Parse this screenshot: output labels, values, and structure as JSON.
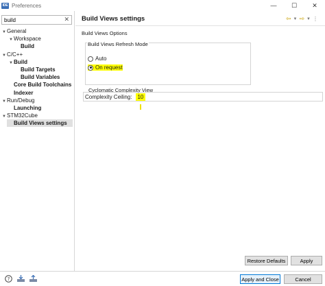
{
  "window": {
    "app_icon_text": "IDE",
    "title": "Preferences",
    "minimize_glyph": "—",
    "maximize_glyph": "☐",
    "close_glyph": "✕"
  },
  "filter": {
    "value": "build",
    "clear_glyph": "✕"
  },
  "tree": [
    {
      "label": "General",
      "indent": 0,
      "arrow": "▼",
      "bold": false,
      "selected": false
    },
    {
      "label": "Workspace",
      "indent": 1,
      "arrow": "▼",
      "bold": false,
      "selected": false
    },
    {
      "label": "Build",
      "indent": 2,
      "arrow": "",
      "bold": true,
      "selected": false
    },
    {
      "label": "C/C++",
      "indent": 0,
      "arrow": "▼",
      "bold": false,
      "selected": false
    },
    {
      "label": "Build",
      "indent": 1,
      "arrow": "▼",
      "bold": true,
      "selected": false
    },
    {
      "label": "Build Targets",
      "indent": 2,
      "arrow": "",
      "bold": true,
      "selected": false
    },
    {
      "label": "Build Variables",
      "indent": 2,
      "arrow": "",
      "bold": true,
      "selected": false
    },
    {
      "label": "Core Build Toolchains",
      "indent": 1,
      "arrow": "",
      "bold": true,
      "selected": false
    },
    {
      "label": "Indexer",
      "indent": 1,
      "arrow": "",
      "bold": true,
      "selected": false
    },
    {
      "label": "Run/Debug",
      "indent": 0,
      "arrow": "▼",
      "bold": false,
      "selected": false
    },
    {
      "label": "Launching",
      "indent": 1,
      "arrow": "",
      "bold": true,
      "selected": false
    },
    {
      "label": "STM32Cube",
      "indent": 0,
      "arrow": "▼",
      "bold": false,
      "selected": false
    },
    {
      "label": "Build Views settings",
      "indent": 1,
      "arrow": "",
      "bold": true,
      "selected": true
    }
  ],
  "page": {
    "title": "Build Views settings",
    "section": "Build Views Options",
    "refresh_group": {
      "label": "Build Views Refresh Mode",
      "option_auto": "Auto",
      "option_on_request": "On request",
      "selected": "On request"
    },
    "complexity_group": {
      "label": "Cyclomatic Complexity View",
      "field_label": "Complexity Ceiling:",
      "field_value": "10"
    }
  },
  "buttons": {
    "restore_defaults": "Restore Defaults",
    "apply": "Apply",
    "apply_and_close": "Apply and Close",
    "cancel": "Cancel"
  },
  "colors": {
    "highlight": "#ffff00",
    "nav_arrow": "#c8a000",
    "primary_border": "#0078d7"
  }
}
